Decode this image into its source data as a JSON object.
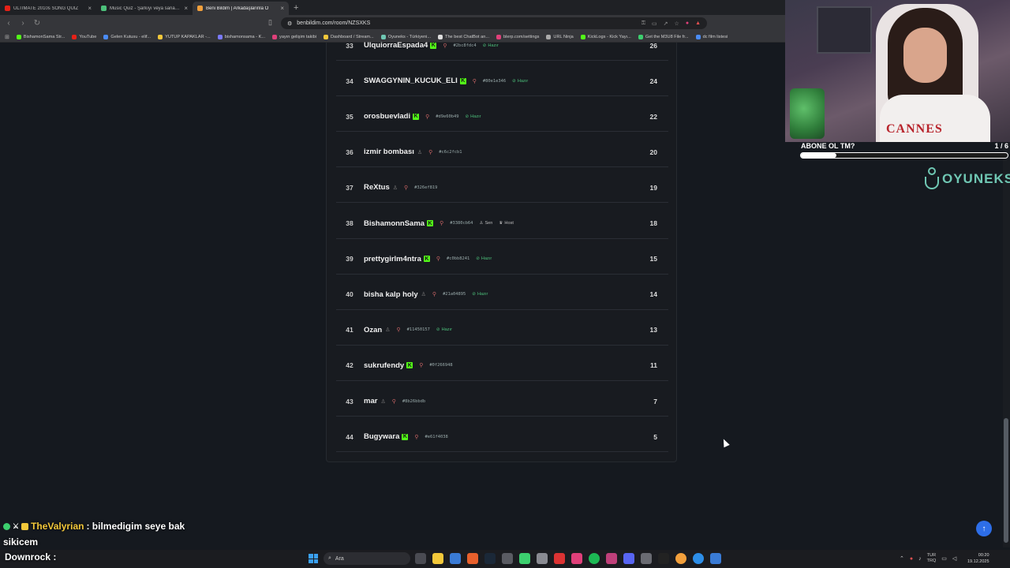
{
  "browser": {
    "tabs": [
      {
        "label": "ULTIMATE 2010s SONG QUIZ",
        "color": "#e62117",
        "active": false
      },
      {
        "label": "Music Quiz - Şarkıyı veya sanatçıyı ta",
        "color": "#4cc07a",
        "active": false
      },
      {
        "label": "Beni Bildim | Arkadaşlarınla O",
        "color": "#f2a03c",
        "active": true
      }
    ],
    "url": "benbildim.com/room/NZSXKS",
    "bookmarks": [
      {
        "label": "BishamonSama Str...",
        "color": "#53fc18"
      },
      {
        "label": "YouTube",
        "color": "#e62117"
      },
      {
        "label": "Gelen Kutusu - elif...",
        "color": "#4a8cf7"
      },
      {
        "label": "YUTUP KAPAKLAR -...",
        "color": "#f3c83a"
      },
      {
        "label": "bishamonsama - K...",
        "color": "#7a7aff"
      },
      {
        "label": "yayın gelişim takibi",
        "color": "#e0407a"
      },
      {
        "label": "Dashboard / Stream...",
        "color": "#f3c83a"
      },
      {
        "label": "Oyuneks - Türkiyeni...",
        "color": "#6fc7b3"
      },
      {
        "label": "The best ChatBot an...",
        "color": "#dddddd"
      },
      {
        "label": "blerp.com/settings",
        "color": "#e0407a"
      },
      {
        "label": "URL Ninja",
        "color": "#aaaaaa"
      },
      {
        "label": "KickLogs - Kick Yayı...",
        "color": "#53fc18"
      },
      {
        "label": "Get the M3U8 File fr...",
        "color": "#3ccf6e"
      },
      {
        "label": "dc film listesi",
        "color": "#4a8cf7"
      }
    ]
  },
  "leaderboard": {
    "rows": [
      {
        "rank": "33",
        "name": "UlquiorraEspada4",
        "kick": true,
        "hash": "#2bc8fdc4",
        "tag": "Hazır",
        "score": "26"
      },
      {
        "rank": "34",
        "name": "SWAGGYNIN_KUCUK_ELI",
        "kick": true,
        "hash": "#80e1e346",
        "tag": "Hazır",
        "score": "24"
      },
      {
        "rank": "35",
        "name": "orosbuevladi",
        "kick": true,
        "hash": "#d9e60b49",
        "tag": "Hazır",
        "score": "22"
      },
      {
        "rank": "36",
        "name": "izmir bombası",
        "kick": false,
        "hash": "#c6c2fcb1",
        "tag": "",
        "score": "20"
      },
      {
        "rank": "37",
        "name": "ReXtus",
        "kick": false,
        "hash": "#326ef819",
        "tag": "",
        "score": "19"
      },
      {
        "rank": "38",
        "name": "BishamonnSama",
        "kick": true,
        "hash": "#3380cb64",
        "tag": "Sen",
        "tag2": "Host",
        "score": "18"
      },
      {
        "rank": "39",
        "name": "prettygirlm4ntra",
        "kick": true,
        "hash": "#c0bb8241",
        "tag": "Hazır",
        "score": "15"
      },
      {
        "rank": "40",
        "name": "bisha kalp holy",
        "kick": false,
        "hash": "#21a04895",
        "tag": "Hazır",
        "score": "14"
      },
      {
        "rank": "41",
        "name": "Ozan",
        "kick": false,
        "hash": "#11450157",
        "tag": "Hazır",
        "score": "13"
      },
      {
        "rank": "42",
        "name": "sukrufendy",
        "kick": true,
        "hash": "#0f266948",
        "tag": "",
        "score": "11"
      },
      {
        "rank": "43",
        "name": "mar",
        "kick": false,
        "hash": "#8b26bbdb",
        "tag": "",
        "score": "7"
      },
      {
        "rank": "44",
        "name": "Bugywara",
        "kick": true,
        "hash": "#e61f4038",
        "tag": "",
        "score": "5"
      }
    ]
  },
  "overlay": {
    "label": "ABONE OL TM?",
    "count": "1 / 6",
    "progress": 0.17,
    "brand": "OYUNEKS",
    "shirt_text": "CANNES"
  },
  "chat": {
    "line1_user": "TheValyrian",
    "line1_text": ": bilmedigim seye bak",
    "line2_text": "sikicem",
    "line3_user": "Downrock :"
  },
  "taskbar": {
    "search": "Ara",
    "lang": "TUR",
    "lang2": "TRQ",
    "time": "00:20",
    "date": "19.12.2025"
  }
}
